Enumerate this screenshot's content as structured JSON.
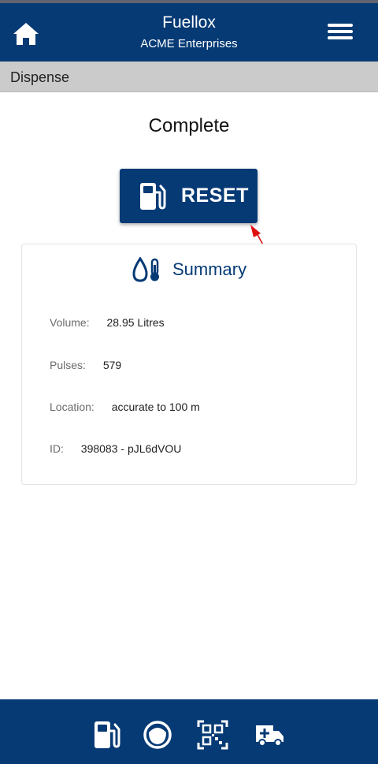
{
  "header": {
    "app_title": "Fuellox",
    "company": "ACME Enterprises"
  },
  "icons": {
    "home": "home-icon",
    "menu": "hamburger-menu-icon",
    "reset": "fuel-pump-icon",
    "summary": "drop-thermometer-icon",
    "nav": [
      "fuel-pump-icon",
      "meter-icon",
      "qr-code-icon",
      "ambulance-icon"
    ]
  },
  "section": {
    "title": "Dispense"
  },
  "status": "Complete",
  "reset_button": {
    "label": "RESET"
  },
  "summary": {
    "title": "Summary",
    "rows": [
      {
        "label": "Volume:",
        "value": "28.95 Litres"
      },
      {
        "label": "Pulses:",
        "value": "579"
      },
      {
        "label": "Location:",
        "value": "accurate to 100 m"
      },
      {
        "label": "ID:",
        "value": "398083 - pJL6dVOU"
      }
    ]
  },
  "colors": {
    "primary": "#053a75",
    "section_bar": "#cbcbcb",
    "annotation_arrow": "#e01010"
  }
}
